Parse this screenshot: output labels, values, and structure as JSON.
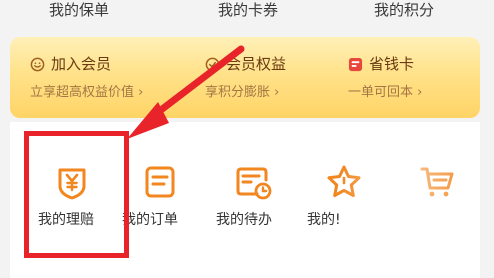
{
  "top_tabs": [
    {
      "label": "我的保单"
    },
    {
      "label": "我的卡券"
    },
    {
      "label": "我的积分"
    }
  ],
  "member_card": {
    "items": [
      {
        "title": "加入会员",
        "subtitle": "立享超高权益价值 ›",
        "icon": "member-smile-icon"
      },
      {
        "title": "会员权益",
        "subtitle": "享积分膨胀 ›",
        "icon": "benefit-icon"
      },
      {
        "title": "省钱卡",
        "subtitle": "一单可回本 ›",
        "icon": "money-card-icon"
      }
    ]
  },
  "services": [
    {
      "label": "我的理赔",
      "icon": "yen-shield-icon"
    },
    {
      "label": "我的订单",
      "icon": "order-doc-icon"
    },
    {
      "label": "我的待办",
      "icon": "todo-clock-icon"
    },
    {
      "label": "我的!",
      "icon": "star-icon"
    },
    {
      "label": "",
      "icon": "cart-icon"
    }
  ],
  "colors": {
    "accent_orange": "#f2861f",
    "highlight_red": "#e8242a",
    "card_top": "#fff0b8",
    "card_bottom": "#ffd466",
    "member_title": "#6b3a10",
    "member_sub": "#a57643"
  }
}
